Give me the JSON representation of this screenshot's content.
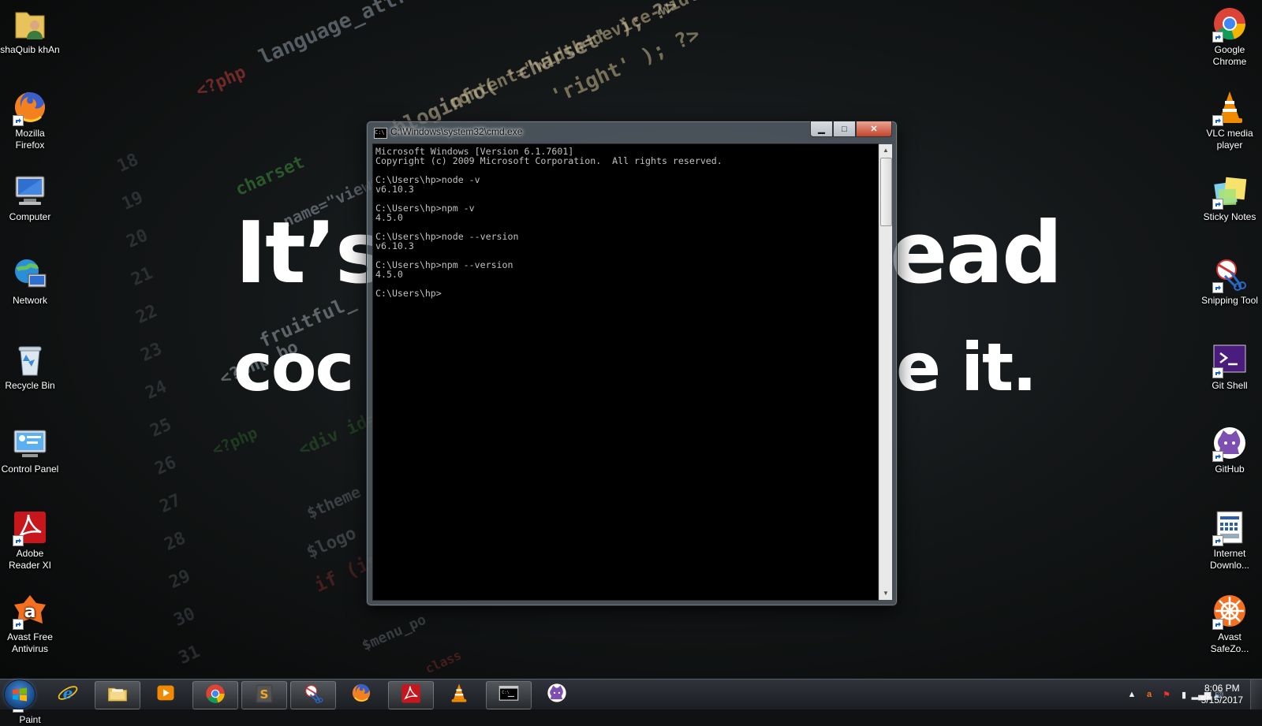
{
  "desktop_left": [
    {
      "label": "shaQuib khAn",
      "icon": "user-folder-icon"
    },
    {
      "label": "Mozilla Firefox",
      "icon": "firefox-icon",
      "shortcut": true
    },
    {
      "label": "Computer",
      "icon": "computer-icon"
    },
    {
      "label": "Network",
      "icon": "network-icon"
    },
    {
      "label": "Recycle Bin",
      "icon": "recycle-bin-icon"
    },
    {
      "label": "Control Panel",
      "icon": "control-panel-icon"
    },
    {
      "label": "Adobe Reader XI",
      "icon": "adobe-reader-icon",
      "shortcut": true
    },
    {
      "label": "Avast Free Antivirus",
      "icon": "avast-icon",
      "shortcut": true
    },
    {
      "label": "Paint",
      "icon": "paint-icon",
      "shortcut": true
    }
  ],
  "desktop_right": [
    {
      "label": "Google Chrome",
      "icon": "chrome-icon",
      "shortcut": true
    },
    {
      "label": "VLC media player",
      "icon": "vlc-icon",
      "shortcut": true
    },
    {
      "label": "Sticky Notes",
      "icon": "sticky-notes-icon",
      "shortcut": true
    },
    {
      "label": "Snipping Tool",
      "icon": "snipping-tool-icon",
      "shortcut": true
    },
    {
      "label": "Git Shell",
      "icon": "git-shell-icon",
      "shortcut": true
    },
    {
      "label": "GitHub",
      "icon": "github-icon",
      "shortcut": true
    },
    {
      "label": "Internet Downlo...",
      "icon": "internet-download-manager-icon",
      "shortcut": true
    },
    {
      "label": "Avast SafeZo...",
      "icon": "avast-safezone-icon",
      "shortcut": true
    }
  ],
  "wallpaper": {
    "headline_line1_left": "It’s",
    "headline_line1_right": "ead",
    "headline_line2_left": "coc",
    "headline_line2_right": "e it.",
    "code_fragments": [
      "bloginfo( 'charset' ); ?>",
      "content=\"width=device-width",
      "'right' ); ?>",
      "language_attributes",
      "<?php",
      "charset",
      "name=\"viewport\"",
      "fruitful_",
      "<?php bo",
      "$theme",
      "$logo",
      "if (is",
      "$menu_po",
      "class",
      "<?php",
      "<div id=\"p"
    ],
    "line_numbers": [
      "18",
      "19",
      "20",
      "21",
      "22",
      "23",
      "24",
      "25",
      "26",
      "27",
      "28",
      "29",
      "30",
      "31"
    ]
  },
  "cmd": {
    "title": "C:\\Windows\\system32\\cmd.exe",
    "title_icon_text": "C:\\",
    "min_label": "▁",
    "max_label": "□",
    "close_label": "✕",
    "output": "Microsoft Windows [Version 6.1.7601]\nCopyright (c) 2009 Microsoft Corporation.  All rights reserved.\n\nC:\\Users\\hp>node -v\nv6.10.3\n\nC:\\Users\\hp>npm -v\n4.5.0\n\nC:\\Users\\hp>node --version\nv6.10.3\n\nC:\\Users\\hp>npm --version\n4.5.0\n\nC:\\Users\\hp>",
    "scroll_up": "▲",
    "scroll_down": "▼"
  },
  "taskbar": {
    "items": [
      {
        "name": "internet-explorer",
        "icon": "internet-explorer-icon",
        "pinned": false
      },
      {
        "name": "windows-explorer",
        "icon": "folder-icon",
        "pinned": true
      },
      {
        "name": "media-player",
        "icon": "media-player-icon",
        "pinned": false
      },
      {
        "name": "chrome",
        "icon": "chrome-icon",
        "pinned": true
      },
      {
        "name": "sublime-text",
        "icon": "sublime-text-icon",
        "pinned": true
      },
      {
        "name": "snipping-tool",
        "icon": "snipping-tool-icon",
        "pinned": true
      },
      {
        "name": "firefox",
        "icon": "firefox-icon",
        "pinned": false
      },
      {
        "name": "adobe-reader",
        "icon": "adobe-reader-icon",
        "pinned": true
      },
      {
        "name": "vlc",
        "icon": "vlc-icon",
        "pinned": false
      },
      {
        "name": "cmd",
        "icon": "cmd-icon",
        "pinned": true
      },
      {
        "name": "github",
        "icon": "github-icon",
        "pinned": false
      }
    ],
    "tray": [
      {
        "name": "show-hidden-icons",
        "glyph": "▲"
      },
      {
        "name": "avast-tray",
        "glyph": "a"
      },
      {
        "name": "action-center-flag",
        "glyph": "⚑"
      },
      {
        "name": "power",
        "glyph": "▮"
      },
      {
        "name": "network-signal",
        "glyph": "▂▄▆"
      },
      {
        "name": "volume",
        "glyph": "🔊"
      }
    ],
    "clock_time": "8:06 PM",
    "clock_date": "5/15/2017"
  },
  "colors": {
    "console_bg": "#000000",
    "console_fg": "#c0c0c0",
    "taskbar": "#1f2328",
    "close_button": "#c4452c"
  }
}
